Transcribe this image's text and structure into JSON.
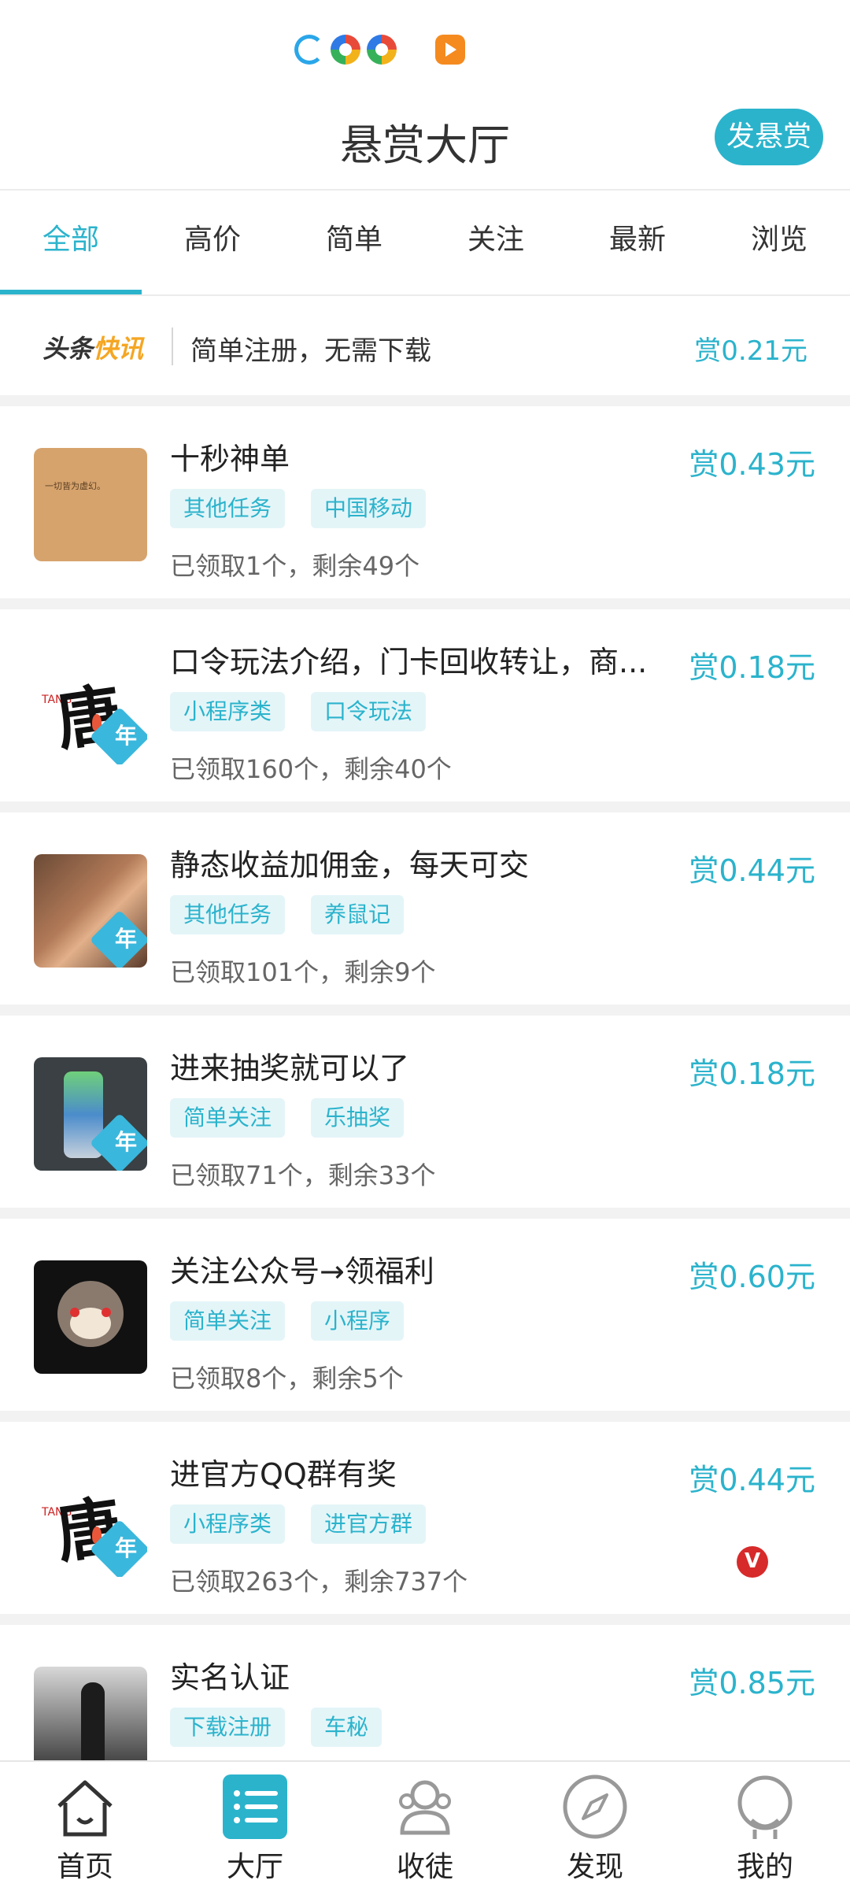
{
  "status_icons": [
    "browser-icon",
    "multicolor-icon",
    "multicolor-icon",
    "video-icon"
  ],
  "header": {
    "title": "悬赏大厅",
    "post_label": "发悬赏"
  },
  "tabs": [
    "全部",
    "高价",
    "简单",
    "关注",
    "最新",
    "浏览"
  ],
  "active_tab": "全部",
  "news": {
    "brand_a": "头条",
    "brand_b": "快讯",
    "text": "简单注册，无需下载",
    "reward": "赏0.21元"
  },
  "tasks": [
    {
      "title": "十秒神单",
      "tags": [
        "其他任务",
        "中国移动"
      ],
      "status": "已领取1个，剩余49个",
      "reward": "赏0.43元",
      "thumb_text": "一切皆为虚幻。"
    },
    {
      "title": "口令玩法介绍，门卡回收转让，商...",
      "tags": [
        "小程序类",
        "口令玩法"
      ],
      "status": "已领取160个，剩余40个",
      "reward": "赏0.18元",
      "thumb_char": "唐",
      "thumb_latin": "TANG"
    },
    {
      "title": "静态收益加佣金，每天可交",
      "tags": [
        "其他任务",
        "养鼠记"
      ],
      "status": "已领取101个，剩余9个",
      "reward": "赏0.44元"
    },
    {
      "title": "进来抽奖就可以了",
      "tags": [
        "简单关注",
        "乐抽奖"
      ],
      "status": "已领取71个，剩余33个",
      "reward": "赏0.18元"
    },
    {
      "title": "关注公众号→领福利",
      "tags": [
        "简单关注",
        "小程序"
      ],
      "status": "已领取8个，剩余5个",
      "reward": "赏0.60元"
    },
    {
      "title": "进官方QQ群有奖",
      "tags": [
        "小程序类",
        "进官方群"
      ],
      "status": "已领取263个，剩余737个",
      "reward": "赏0.44元",
      "thumb_char": "唐",
      "thumb_latin": "TANG"
    },
    {
      "title": "实名认证",
      "tags": [
        "下载注册",
        "车秘"
      ],
      "status": "",
      "reward": "赏0.85元"
    }
  ],
  "badge_label": "年",
  "red_mark": "V",
  "bottom_nav": [
    {
      "label": "首页",
      "icon": "home-icon"
    },
    {
      "label": "大厅",
      "icon": "list-icon"
    },
    {
      "label": "收徒",
      "icon": "users-icon"
    },
    {
      "label": "发现",
      "icon": "compass-icon"
    },
    {
      "label": "我的",
      "icon": "profile-icon"
    }
  ],
  "colors": {
    "accent": "#2bb3cc",
    "tag_bg": "#e4f5f8"
  }
}
